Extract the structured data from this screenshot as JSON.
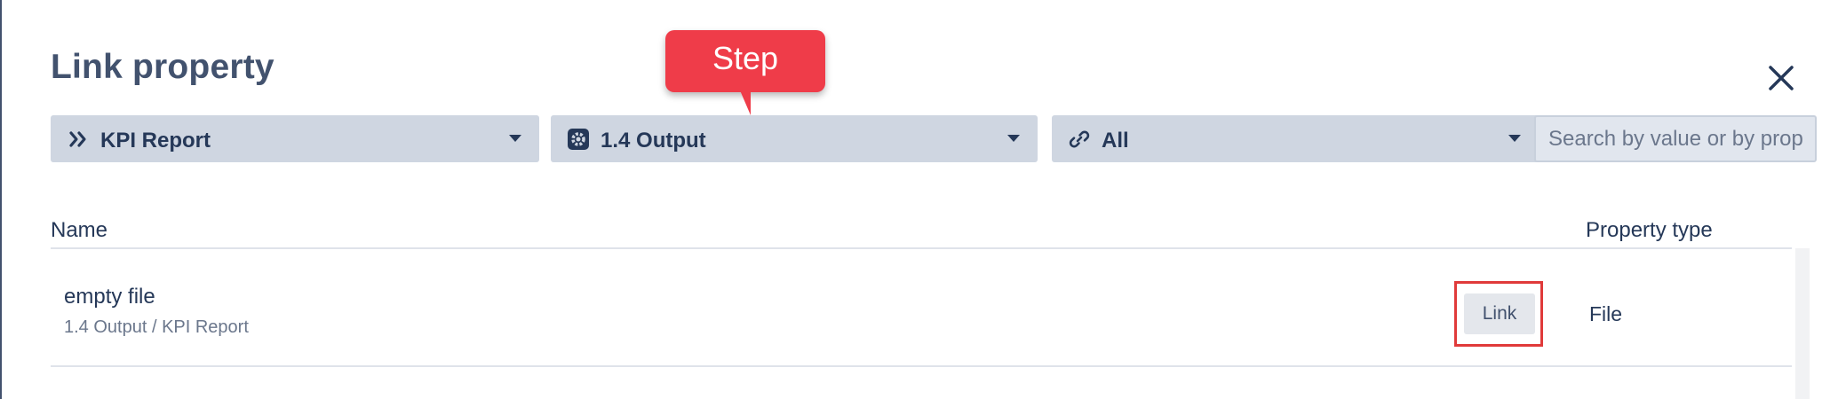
{
  "dialog": {
    "title": "Link property",
    "close_icon": "close-icon"
  },
  "filters": [
    {
      "label": "KPI Report",
      "icon": "double-chevron-right-icon"
    },
    {
      "label": "1.4 Output",
      "icon": "gear-icon"
    },
    {
      "label": "All",
      "icon": "link-icon"
    }
  ],
  "search": {
    "placeholder": "Search by value or by prop"
  },
  "tooltip": {
    "text": "Step",
    "color": "#ef3c49"
  },
  "table": {
    "columns": {
      "name": "Name",
      "property_type": "Property type"
    },
    "rows": [
      {
        "name": "empty file",
        "path": "1.4 Output / KPI Report",
        "action_label": "Link",
        "property_type": "File"
      }
    ]
  },
  "colors": {
    "title": "#42526e",
    "dropdown_bg": "#cfd6e1",
    "highlight_border": "#e03a3a"
  }
}
